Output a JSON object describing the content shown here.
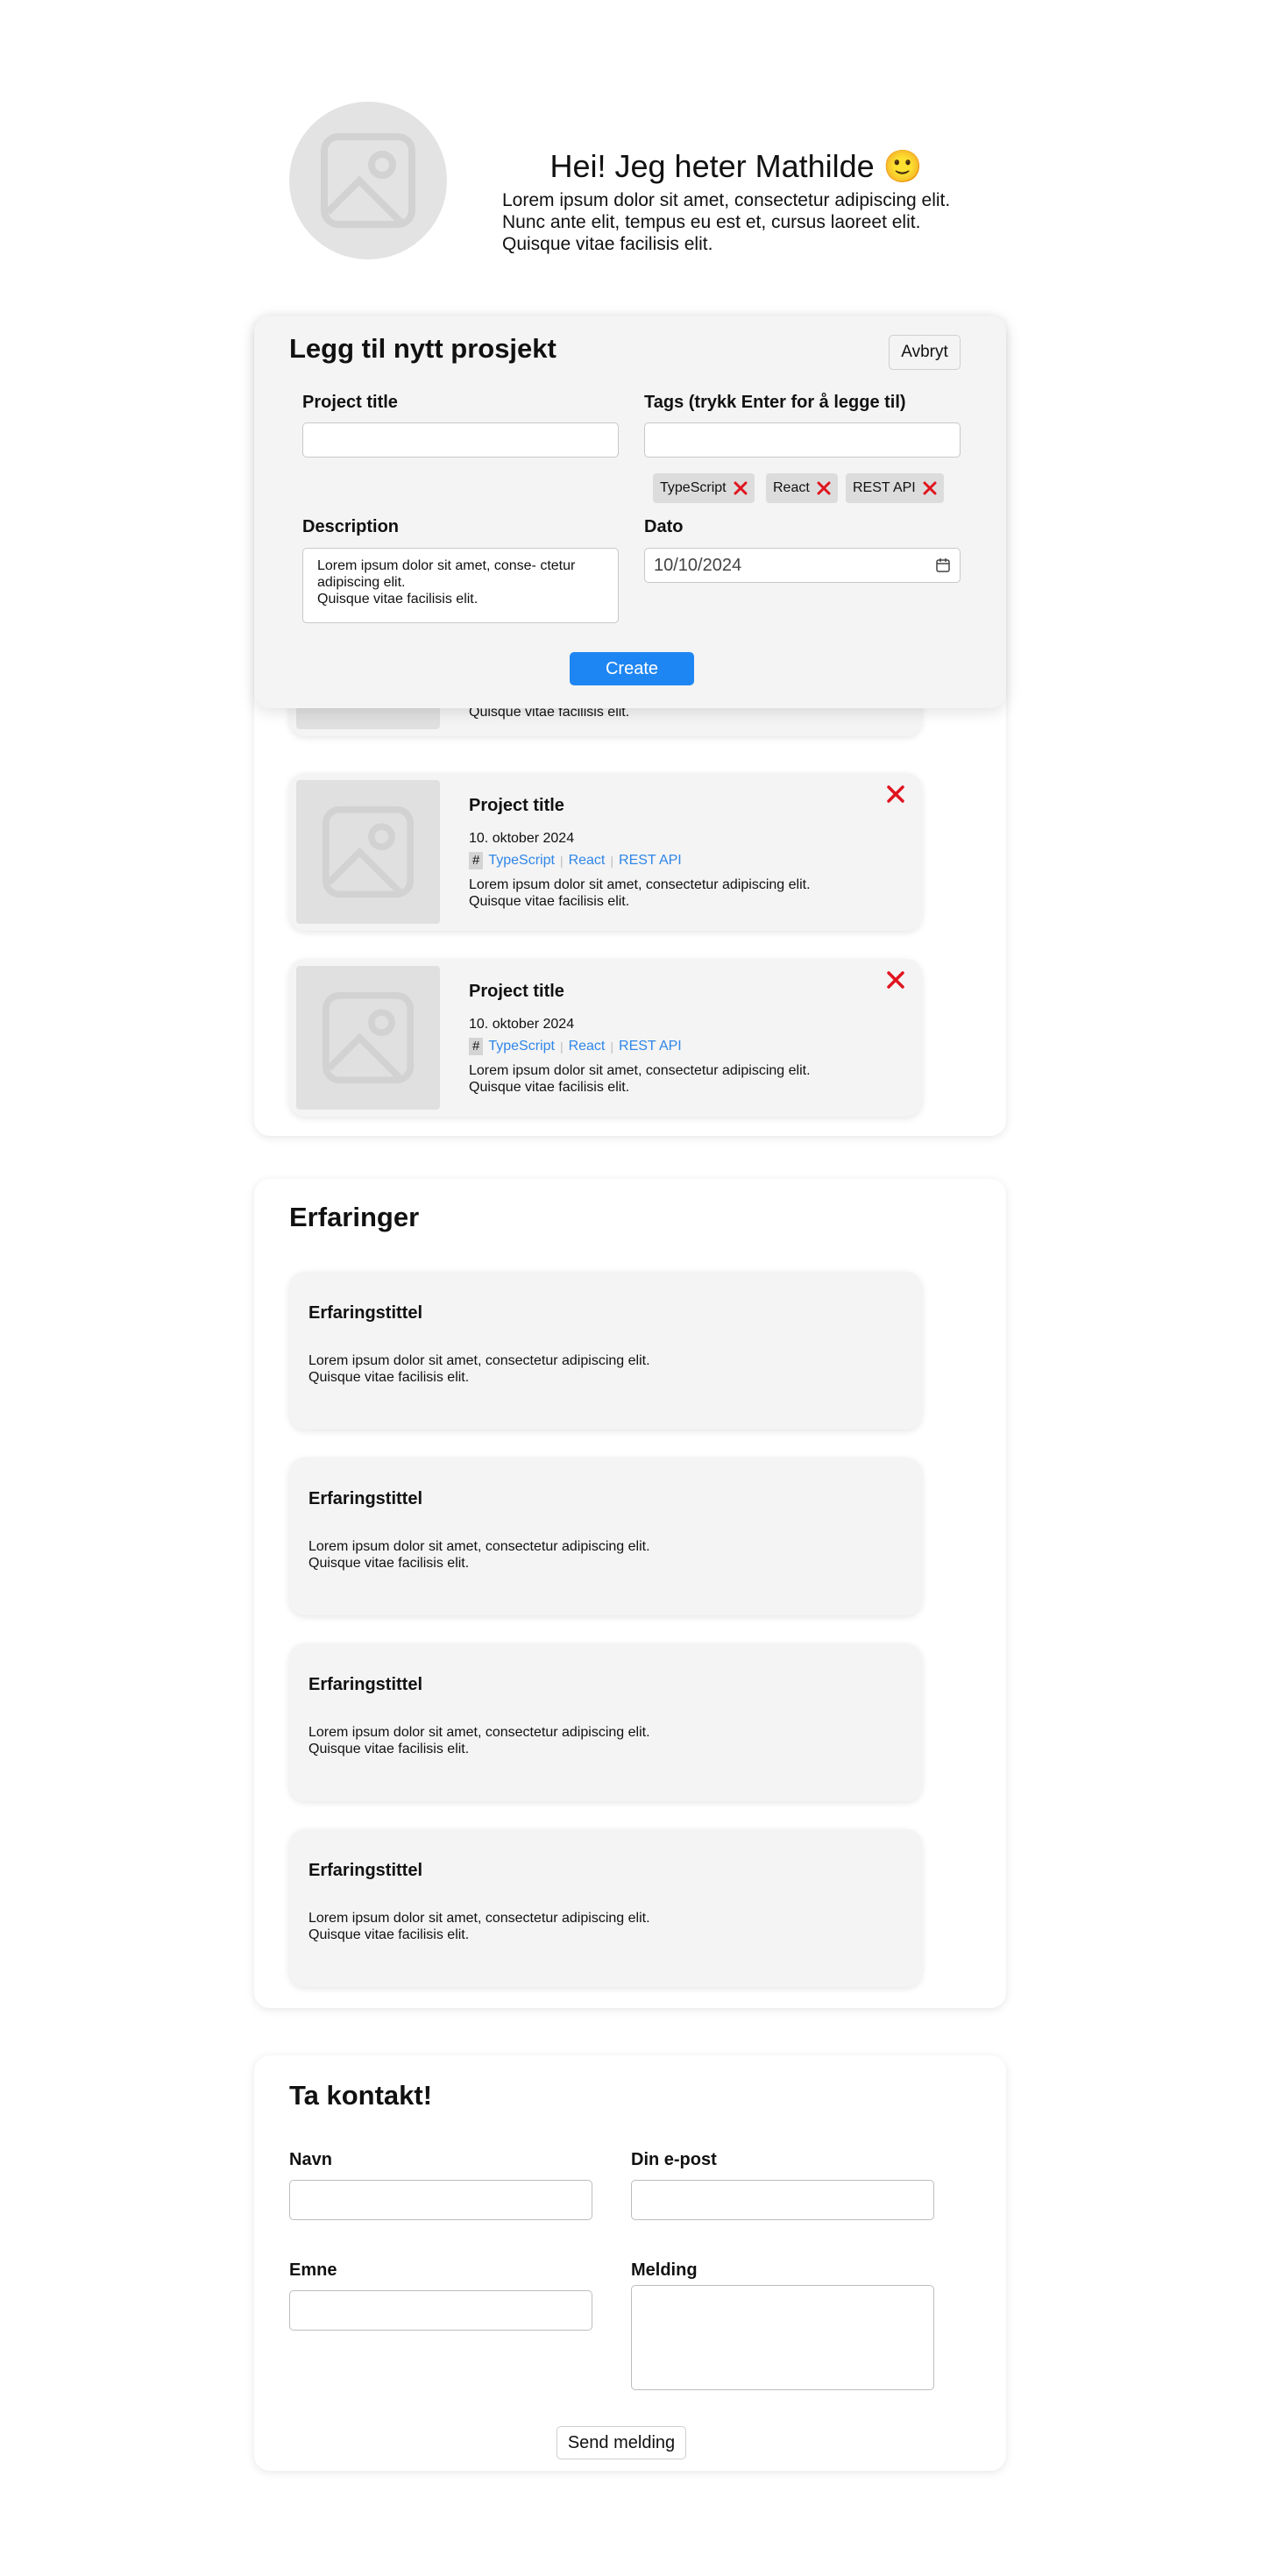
{
  "header": {
    "title": "Hei! Jeg heter Mathilde 🙂",
    "intro_lines": [
      "Lorem ipsum dolor sit amet, consectetur adipiscing elit.",
      "Nunc ante elit, tempus eu est et, cursus laoreet elit.",
      "Quisque vitae  facilisis elit."
    ],
    "avatar_icon": "image-placeholder-icon"
  },
  "modal": {
    "title": "Legg til nytt prosjekt",
    "cancel_label": "Avbryt",
    "project_title_label": "Project title",
    "project_title_value": "",
    "tags_label": "Tags (trykk Enter for å legge til)",
    "tags_value": "",
    "chips": [
      "TypeScript",
      "React",
      "REST API"
    ],
    "description_label": "Description",
    "description_lines": [
      "Lorem ipsum dolor sit amet, conse- ctetur adipiscing elit.",
      "Quisque vitae  facilisis elit."
    ],
    "date_label": "Dato",
    "date_value": "10/10/2024",
    "create_label": "Create"
  },
  "projects": {
    "peek_text": "Quisque vitae  facilisis elit.",
    "items": [
      {
        "title": "Project title",
        "date": "10. oktober 2024",
        "hash": "#",
        "tags": [
          "TypeScript",
          "React",
          "REST API"
        ],
        "desc_lines": [
          "Lorem ipsum dolor sit amet, consectetur adipiscing elit.",
          "Quisque vitae  facilisis elit."
        ]
      },
      {
        "title": "Project title",
        "date": "10. oktober 2024",
        "hash": "#",
        "tags": [
          "TypeScript",
          "React",
          "REST API"
        ],
        "desc_lines": [
          "Lorem ipsum dolor sit amet, consectetur adipiscing elit.",
          "Quisque vitae  facilisis elit."
        ]
      }
    ],
    "tag_separator": "|"
  },
  "experience": {
    "heading": "Erfaringer",
    "items": [
      {
        "title": "Erfaringstittel",
        "desc_lines": [
          "Lorem ipsum dolor sit amet, consectetur adipiscing elit.",
          "Quisque vitae  facilisis elit."
        ]
      },
      {
        "title": "Erfaringstittel",
        "desc_lines": [
          "Lorem ipsum dolor sit amet, consectetur adipiscing elit.",
          "Quisque vitae  facilisis elit."
        ]
      },
      {
        "title": "Erfaringstittel",
        "desc_lines": [
          "Lorem ipsum dolor sit amet, consectetur adipiscing elit.",
          "Quisque vitae  facilisis elit."
        ]
      },
      {
        "title": "Erfaringstittel",
        "desc_lines": [
          "Lorem ipsum dolor sit amet, consectetur adipiscing elit.",
          "Quisque vitae  facilisis elit."
        ]
      }
    ]
  },
  "contact": {
    "heading": "Ta kontakt!",
    "name_label": "Navn",
    "email_label": "Din e-post",
    "subject_label": "Emne",
    "message_label": "Melding",
    "send_label": "Send melding"
  },
  "colors": {
    "accent": "#1e86f2",
    "delete": "#e0141e",
    "tag_link": "#2f86e8",
    "card_bg": "#f4f4f4"
  }
}
